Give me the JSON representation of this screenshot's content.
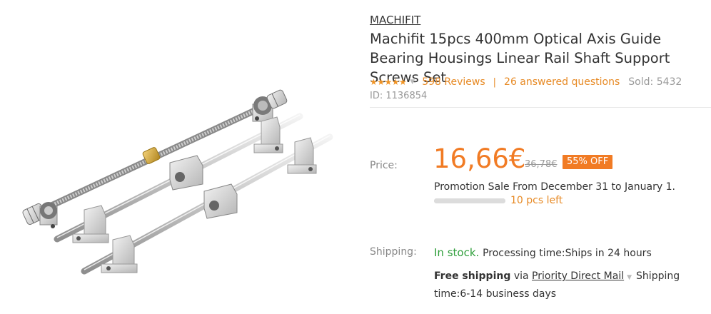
{
  "brand": "MACHIFIT",
  "title": "Machifit 15pcs 400mm Optical Axis Guide Bearing Housings Linear Rail Shaft Support Screws Set",
  "rating": {
    "stars": 5,
    "stars_glyph": "★★★★★",
    "caret": "▼"
  },
  "reviews_label": "598 Reviews",
  "separator": "|",
  "questions_label": "26 answered questions",
  "sold_label": "Sold: 5432",
  "product_id": "ID: 1136854",
  "price": {
    "label": "Price:",
    "current": "16,66€",
    "original": "36,78€",
    "discount": "55% OFF"
  },
  "promotion": {
    "text": "Promotion Sale From December 31 to January 1.",
    "remaining": "10 pcs left"
  },
  "shipping": {
    "label": "Shipping:",
    "stock": "In stock.",
    "processing": "Processing time:Ships in 24 hours",
    "free": "Free shipping",
    "via": " via ",
    "carrier": "Priority Direct Mail",
    "caret": "▼",
    "time": "Shipping time:6-14 business days"
  },
  "colors": {
    "accent": "#f17b24",
    "link": "#e78a25",
    "stock": "#2e9e3a"
  }
}
